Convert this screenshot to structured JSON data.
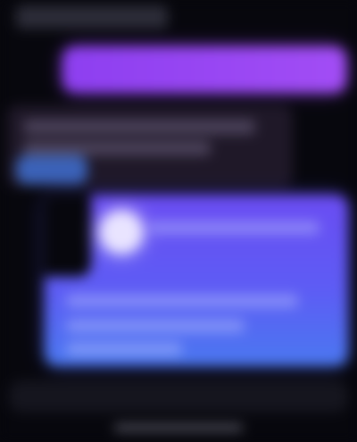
{
  "header": {
    "caption": ""
  },
  "conversation": {
    "outgoing_message": "",
    "incoming_message": ""
  },
  "promo_card": {
    "title": "",
    "body": ""
  },
  "composer": {
    "placeholder": ""
  },
  "colors": {
    "background": "#07070d",
    "outgoing_bubble": "#9a46f3",
    "incoming_bubble": "#1f1828",
    "promo_gradient_top": "#6a4cf2",
    "promo_gradient_bottom": "#4a78f0",
    "chip": "#3b62b8"
  },
  "icons": {
    "orb": "glowing-orb-icon"
  }
}
